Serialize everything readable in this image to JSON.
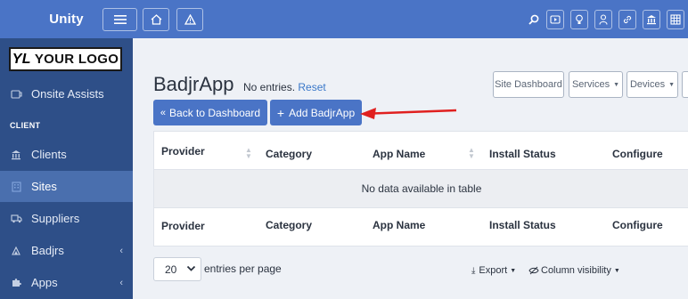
{
  "topbar": {
    "brand": "Unity"
  },
  "logo": {
    "mark": "YL",
    "text": "YOUR LOGO"
  },
  "sidebar": {
    "section_client": "CLIENT",
    "items": [
      {
        "label": "Onsite Assists",
        "icon": "clipboard-icon"
      },
      {
        "label": "Clients",
        "icon": "bank-icon"
      },
      {
        "label": "Sites",
        "icon": "building-icon"
      },
      {
        "label": "Suppliers",
        "icon": "truck-icon"
      },
      {
        "label": "Badjrs",
        "icon": "badge-icon"
      },
      {
        "label": "Apps",
        "icon": "puzzle-icon"
      }
    ]
  },
  "main": {
    "title": "BadjrApp",
    "entries_info": "No entries.",
    "reset": "Reset",
    "back_button": "Back to Dashboard",
    "add_button": "Add BadjrApp",
    "site_dashboard": "Site Dashboard",
    "services": "Services",
    "devices": "Devices"
  },
  "table": {
    "columns": [
      "Provider",
      "Category",
      "App Name",
      "Install Status",
      "Configure"
    ],
    "empty_message": "No data available in table"
  },
  "footer": {
    "page_size": "20",
    "per_page_label": "entries per page",
    "export_label": "Export",
    "column_visibility_label": "Column visibility"
  },
  "colors": {
    "primary": "#4a74c6",
    "sidebar": "#2e4f88",
    "annotation_arrow": "#e0201f"
  }
}
